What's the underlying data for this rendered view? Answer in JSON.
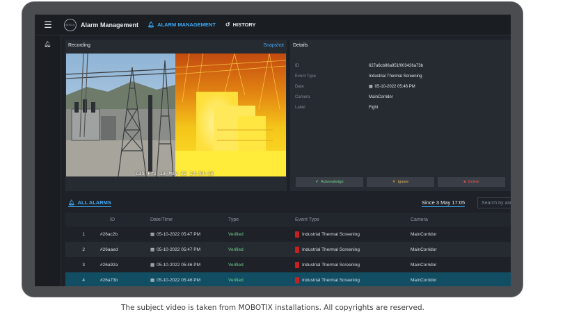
{
  "topbar": {
    "app_title": "Alarm Management",
    "logo_text": "BOSLA",
    "nav": [
      {
        "label": "ALARM MANAGEMENT",
        "icon": "bell-icon"
      },
      {
        "label": "HISTORY",
        "icon": "history-icon"
      }
    ]
  },
  "recording": {
    "title": "Recording",
    "snapshot_label": "Snapshot",
    "osd_text": "C35 Fri 13-May-22 14:54:18"
  },
  "details": {
    "title": "Details",
    "rows": [
      {
        "label": "ID",
        "value": "627a6cb86a951f003426a73b"
      },
      {
        "label": "Event Type",
        "value": "Industrial Thermal Screening"
      },
      {
        "label": "Date",
        "value": "05-10-2022 05:46 PM"
      },
      {
        "label": "Camera",
        "value": "MainCorridor"
      },
      {
        "label": "Label",
        "value": "Fight"
      }
    ],
    "actions": {
      "acknowledge": "Acknowledge",
      "ignore": "Ignore",
      "delete": "Delete"
    }
  },
  "alarms": {
    "title": "ALL ALARMS",
    "since": "Since 3 May 17:05",
    "search_placeholder": "Search by alarm",
    "columns": {
      "id": "ID",
      "date": "Date/Time",
      "type": "Type",
      "event": "Event Type",
      "camera": "Camera"
    },
    "rows": [
      {
        "num": "1",
        "id": "#26ac2b",
        "date": "05-10-2022 05:47 PM",
        "type": "Verified",
        "event": "Industrial Thermal Screening",
        "camera": "MainCorridor"
      },
      {
        "num": "2",
        "id": "#26aaed",
        "date": "05-10-2022 05:47 PM",
        "type": "Verified",
        "event": "Industrial Thermal Screening",
        "camera": "MainCorridor"
      },
      {
        "num": "3",
        "id": "#26a92a",
        "date": "05-10-2022 05:46 PM",
        "type": "Verified",
        "event": "Industrial Thermal Screening",
        "camera": "MainCorridor"
      },
      {
        "num": "4",
        "id": "#26a73b",
        "date": "05-10-2022 05:46 PM",
        "type": "Verified",
        "event": "Industrial Thermal Screening",
        "camera": "MainCorridor"
      }
    ]
  },
  "caption": "The subject video is taken from MOBOTIX installations. All copyrights are reserved.",
  "colors": {
    "accent": "#3fa9f5",
    "verified": "#6fd08c",
    "selected_row": "#114e63",
    "alarm_flag": "#c62020"
  }
}
